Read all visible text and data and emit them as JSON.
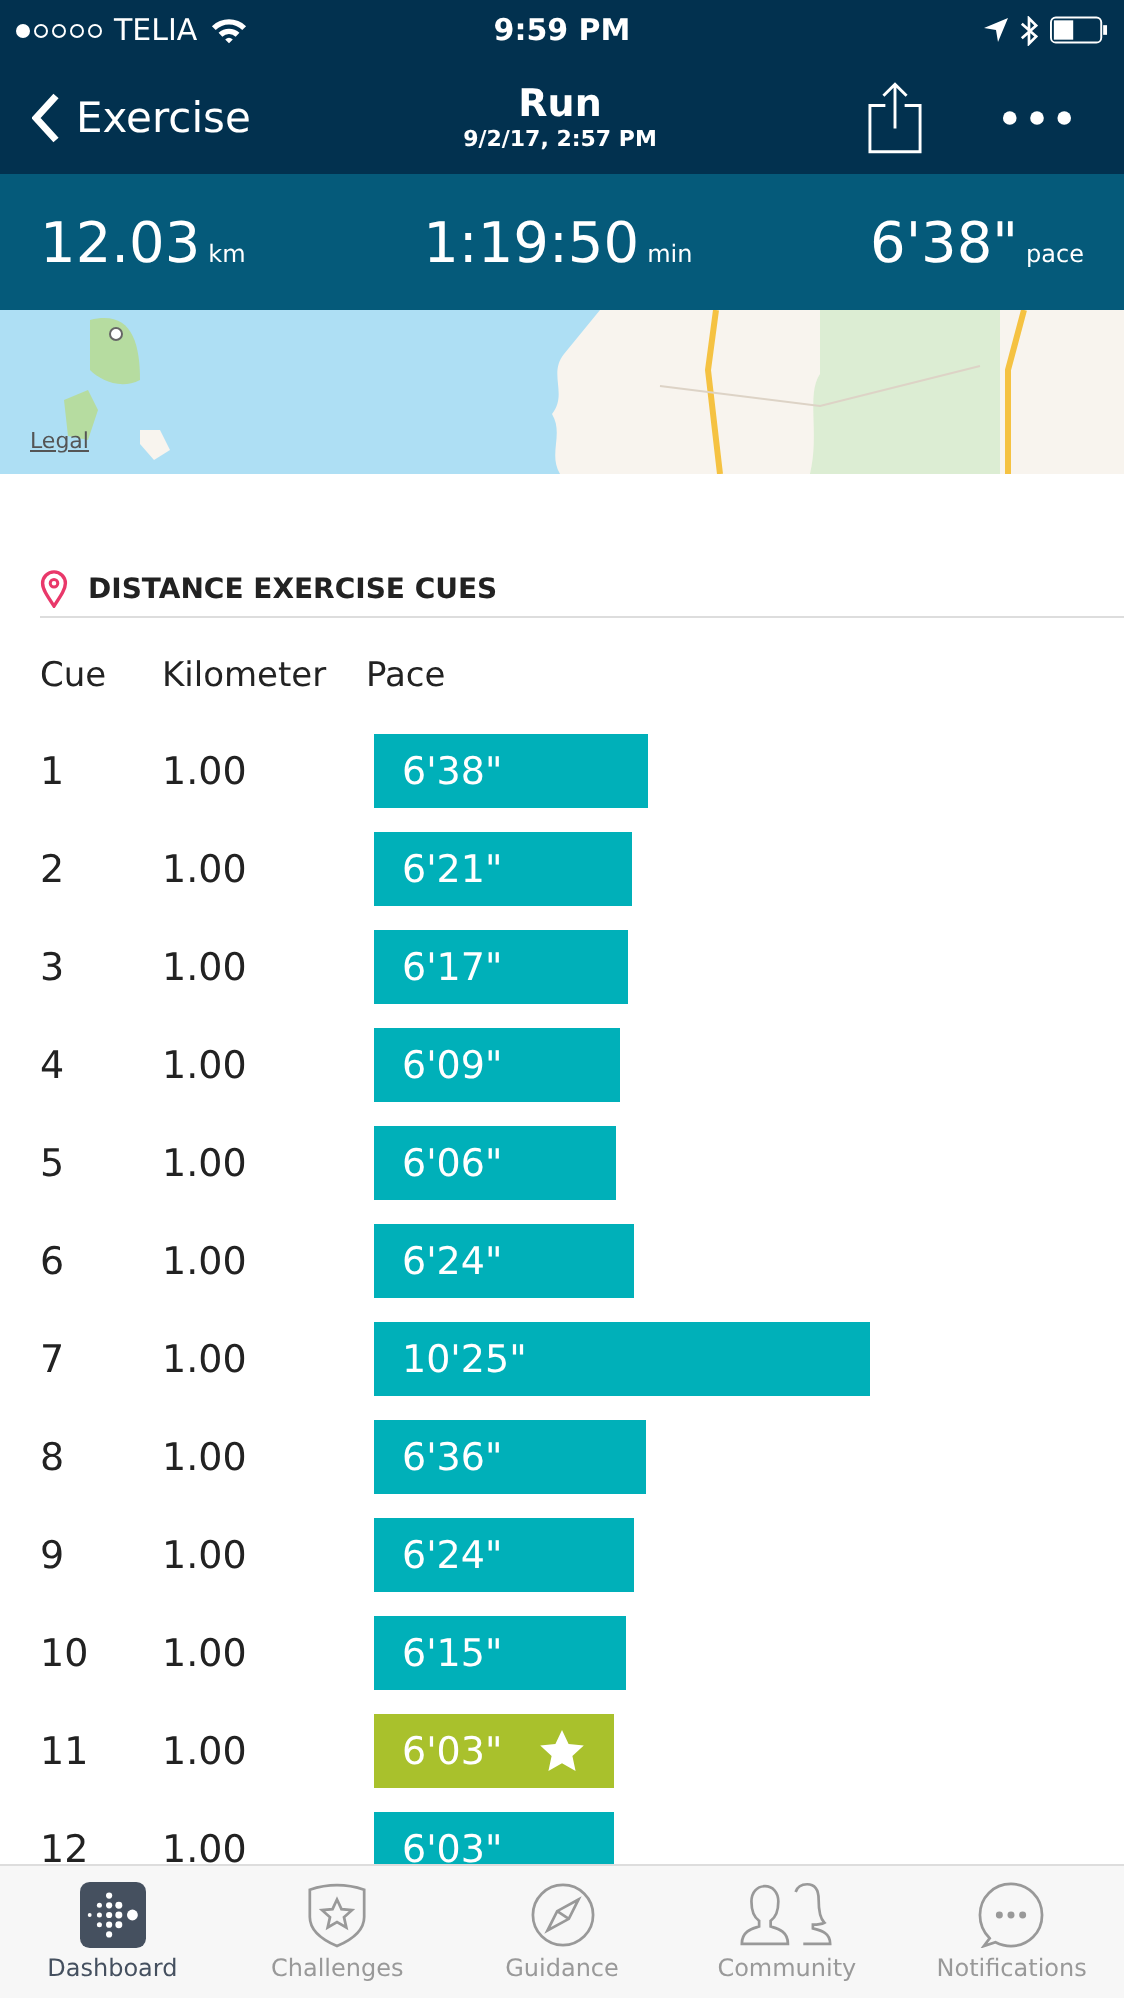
{
  "status_bar": {
    "carrier": "TELIA",
    "time": "9:59 PM"
  },
  "nav": {
    "back": "Exercise",
    "title": "Run",
    "subtitle": "9/2/17, 2:57 PM"
  },
  "stats": [
    {
      "value": "12.03",
      "unit": "km"
    },
    {
      "value": "1:19:50",
      "unit": "min"
    },
    {
      "value": "6'38\"",
      "unit": "pace"
    }
  ],
  "map": {
    "kind": "picture",
    "legal": "Legal"
  },
  "cues": {
    "title": "DISTANCE EXERCISE CUES",
    "columns": [
      "Cue",
      "Kilometer",
      "Pace"
    ],
    "rows": [
      {
        "cue": "1",
        "km": "1.00",
        "pace": "6'38\"",
        "best": false
      },
      {
        "cue": "2",
        "km": "1.00",
        "pace": "6'21\"",
        "best": false
      },
      {
        "cue": "3",
        "km": "1.00",
        "pace": "6'17\"",
        "best": false
      },
      {
        "cue": "4",
        "km": "1.00",
        "pace": "6'09\"",
        "best": false
      },
      {
        "cue": "5",
        "km": "1.00",
        "pace": "6'06\"",
        "best": false
      },
      {
        "cue": "6",
        "km": "1.00",
        "pace": "6'24\"",
        "best": false
      },
      {
        "cue": "7",
        "km": "1.00",
        "pace": "10'25\"",
        "best": false
      },
      {
        "cue": "8",
        "km": "1.00",
        "pace": "6'36\"",
        "best": false
      },
      {
        "cue": "9",
        "km": "1.00",
        "pace": "6'24\"",
        "best": false
      },
      {
        "cue": "10",
        "km": "1.00",
        "pace": "6'15\"",
        "best": false
      },
      {
        "cue": "11",
        "km": "1.00",
        "pace": "6'03\"",
        "best": true
      },
      {
        "cue": "12",
        "km": "1.00",
        "pace": "6'03\"",
        "best": false
      }
    ]
  },
  "tabs": [
    {
      "label": "Dashboard",
      "kind": "dashboard",
      "selected": true
    },
    {
      "label": "Challenges",
      "kind": "challenges",
      "selected": false
    },
    {
      "label": "Guidance",
      "kind": "guidance",
      "selected": false
    },
    {
      "label": "Community",
      "kind": "community",
      "selected": false
    },
    {
      "label": "Notifications",
      "kind": "notifications",
      "selected": false
    }
  ]
}
